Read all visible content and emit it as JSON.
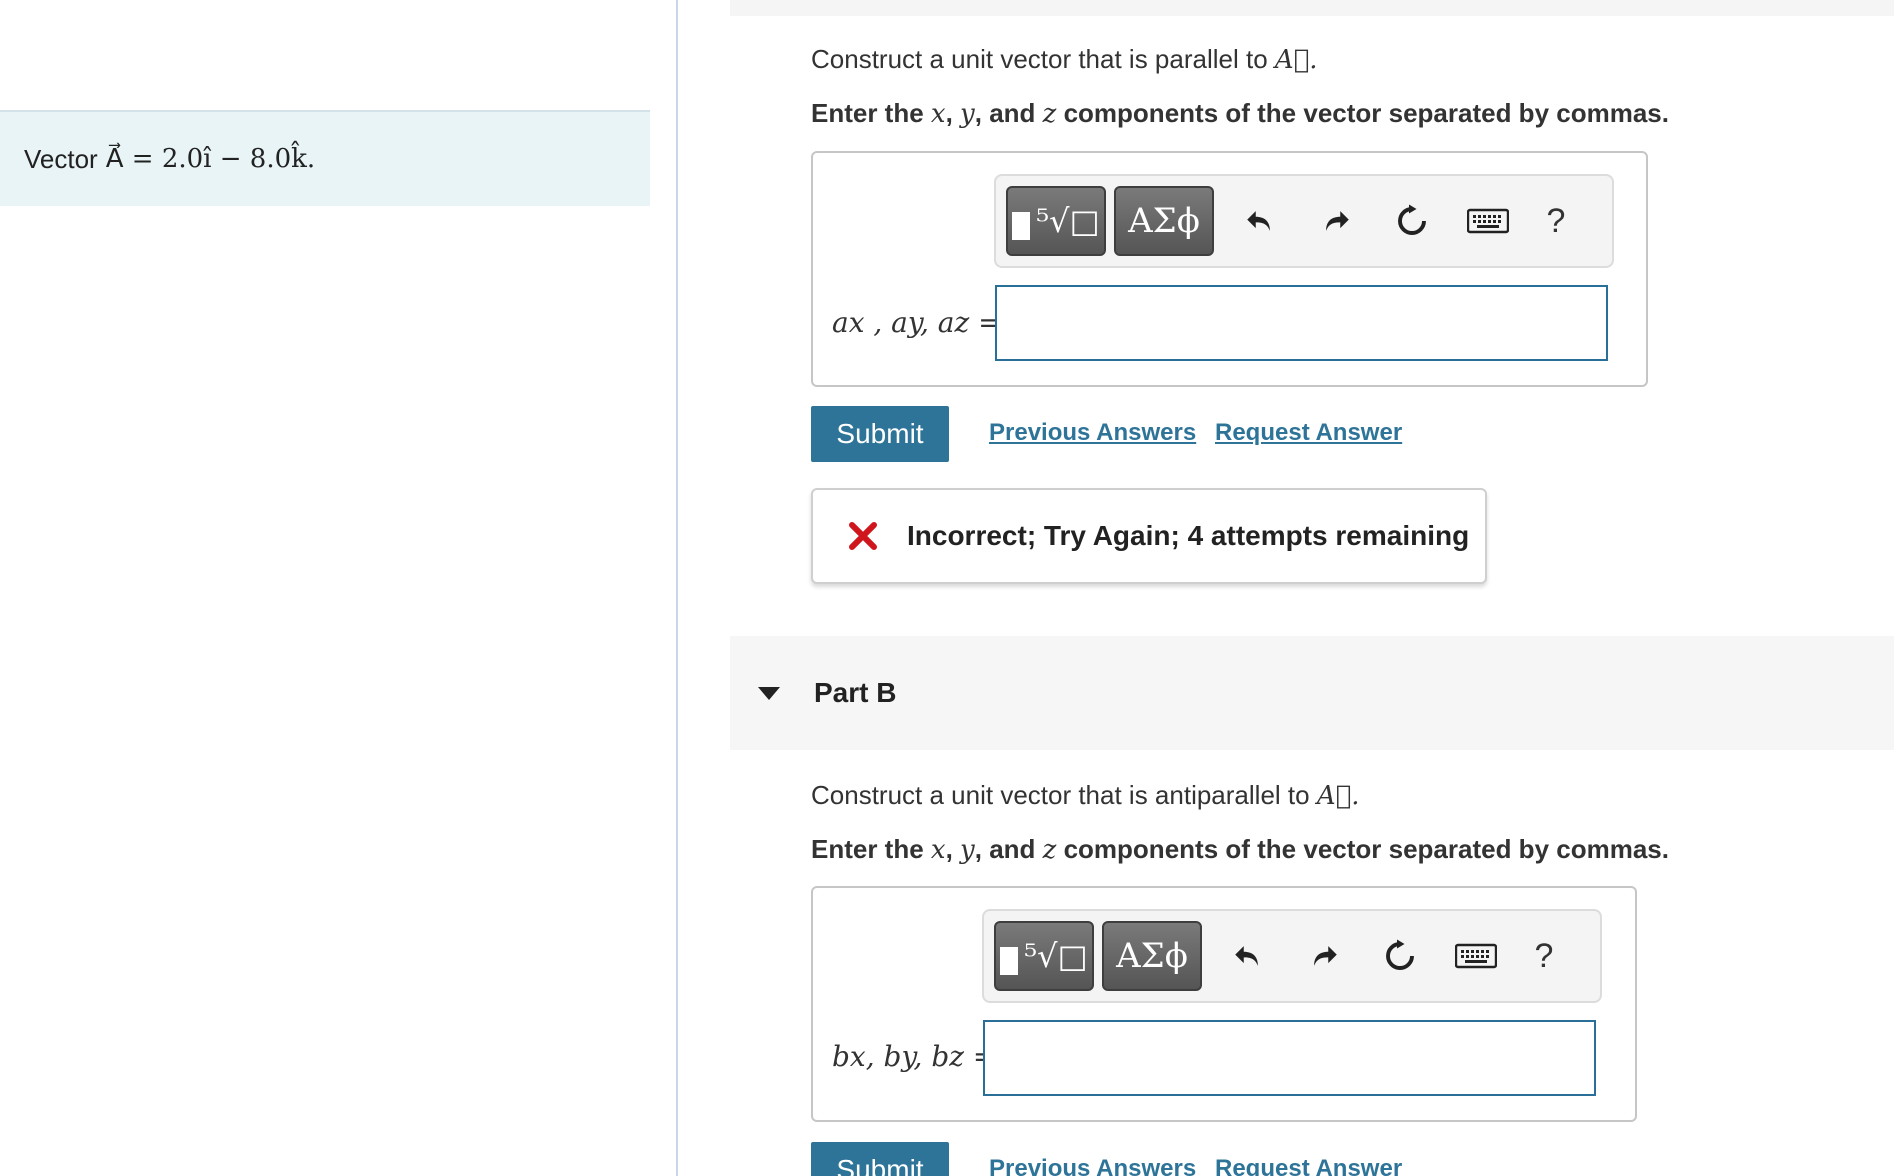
{
  "given": {
    "label": "Vector",
    "expression": "A⃗ = 2.0î − 8.0k̂."
  },
  "part_a": {
    "prompt": "Construct a unit vector that is parallel to",
    "prompt_symbol": "A⃗.",
    "instruction_pre": "Enter the ",
    "instruction_x": "x",
    "instruction_y": "y",
    "instruction_and": ", and ",
    "instruction_z": "z",
    "instruction_post": " components of the vector separated by commas.",
    "var_label": "ax , ay, az =",
    "input_value": "",
    "submit_label": "Submit",
    "previous_answers_label": "Previous Answers",
    "request_answer_label": "Request Answer",
    "feedback": "Incorrect; Try Again; 4 attempts remaining"
  },
  "part_b": {
    "title": "Part B",
    "prompt": "Construct a unit vector that is antiparallel to",
    "prompt_symbol": "A⃗.",
    "instruction_pre": "Enter the ",
    "instruction_x": "x",
    "instruction_y": "y",
    "instruction_and": ", and ",
    "instruction_z": "z",
    "instruction_post": " components of the vector separated by commas.",
    "var_label": "bx, by, bz =",
    "input_value": "",
    "submit_label": "Submit",
    "previous_answers_label": "Previous Answers",
    "request_answer_label": "Request Answer"
  },
  "toolbar": {
    "templates_icon": "templates-icon",
    "greek_label": "ΑΣϕ",
    "undo_icon": "undo-icon",
    "redo_icon": "redo-icon",
    "reset_icon": "reset-icon",
    "keyboard_icon": "keyboard-icon",
    "help_label": "?"
  },
  "colors": {
    "accent": "#2e7499",
    "error": "#d0161d",
    "given_bg": "#e8f4f6"
  }
}
